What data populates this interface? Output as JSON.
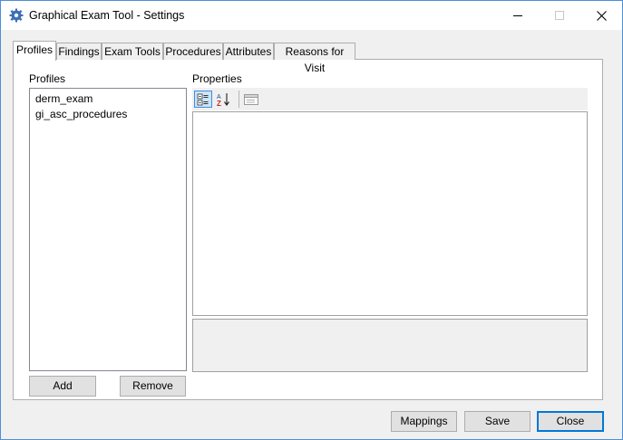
{
  "window": {
    "title": "Graphical Exam Tool - Settings",
    "icon": "settings-gear-icon"
  },
  "tabs": [
    {
      "label": "Profiles",
      "active": true
    },
    {
      "label": "Findings",
      "active": false
    },
    {
      "label": "Exam Tools",
      "active": false
    },
    {
      "label": "Procedures",
      "active": false
    },
    {
      "label": "Attributes",
      "active": false
    },
    {
      "label": "Reasons for Visit",
      "active": false
    }
  ],
  "profiles": {
    "label": "Profiles",
    "items": [
      "derm_exam",
      "gi_asc_procedures"
    ],
    "add_label": "Add",
    "remove_label": "Remove"
  },
  "properties": {
    "label": "Properties",
    "toolbar": [
      "categorized-icon",
      "alphabetical-sort-icon",
      "property-pages-icon"
    ]
  },
  "footer": {
    "mappings_label": "Mappings",
    "save_label": "Save",
    "close_label": "Close"
  },
  "colors": {
    "accent": "#0078d7",
    "pressed": "#cce4f7"
  }
}
